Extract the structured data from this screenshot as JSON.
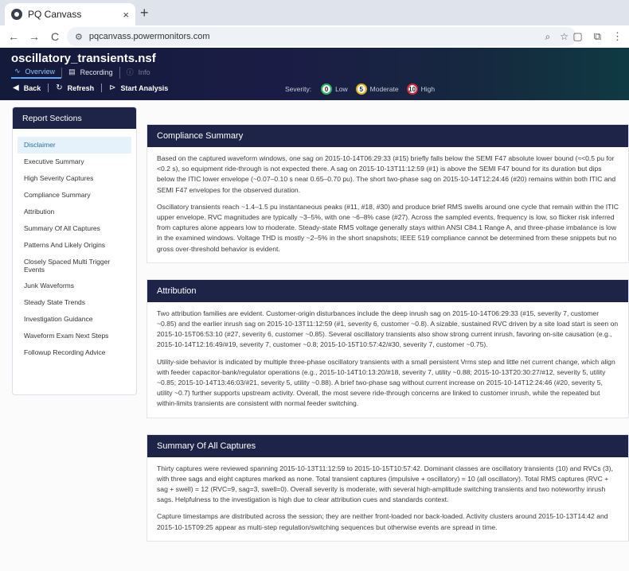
{
  "browser": {
    "tab_title": "PQ Canvass",
    "tab_close": "×",
    "new_tab": "+",
    "back": "←",
    "forward": "→",
    "reload": "C",
    "url": "pqcanvass.powermonitors.com"
  },
  "app": {
    "file_title": "oscillatory_transients.nsf",
    "nav": [
      {
        "label": "Overview",
        "state": "active"
      },
      {
        "label": "Recording",
        "state": "normal"
      },
      {
        "label": "Info",
        "state": "disabled"
      }
    ],
    "actions": {
      "back": "Back",
      "refresh": "Refresh",
      "start_analysis": "Start Analysis"
    },
    "severity": {
      "label": "Severity:",
      "levels": [
        {
          "badge": "0",
          "label": "Low",
          "color": "#2ab35a"
        },
        {
          "badge": "5",
          "label": "Moderate",
          "color": "#e0b21a"
        },
        {
          "badge": "10",
          "label": "High",
          "color": "#d6263a"
        }
      ]
    }
  },
  "sidebar": {
    "title": "Report Sections",
    "items": [
      "Disclaimer",
      "Executive Summary",
      "High Severity Captures",
      "Compliance Summary",
      "Attribution",
      "Summary Of All Captures",
      "Patterns And Likely Origins",
      "Closely Spaced Multi Trigger Events",
      "Junk Waveforms",
      "Steady State Trends",
      "Investigation Guidance",
      "Waveform Exam Next Steps",
      "Followup Recording Advice"
    ],
    "selected": "Disclaimer"
  },
  "sections": [
    {
      "title": "Compliance Summary",
      "paragraphs": [
        "Based on the captured waveform windows, one sag on 2015-10-14T06:29:33 (#15) briefly falls below the SEMI F47 absolute lower bound (≈<0.5 pu for <0.2 s), so equipment ride-through is not expected there. A sag on 2015-10-13T11:12:59 (#1) is above the SEMI F47 bound for its duration but dips below the ITIC lower envelope (~0.07–0.10 s near 0.65–0.70 pu). The short two-phase sag on 2015-10-14T12:24:46 (#20) remains within both ITIC and SEMI F47 envelopes for the observed duration.",
        "Oscillatory transients reach ~1.4–1.5 pu instantaneous peaks (#11, #18, #30) and produce brief RMS swells around one cycle that remain within the ITIC upper envelope. RVC magnitudes are typically ~3–5%, with one ~6–8% case (#27). Across the sampled events, frequency is low, so flicker risk inferred from captures alone appears low to moderate. Steady-state RMS voltage generally stays within ANSI C84.1 Range A, and three-phase imbalance is low in the examined windows. Voltage THD is mostly ~2–5% in the short snapshots; IEEE 519 compliance cannot be determined from these snippets but no gross over-threshold behavior is evident."
      ]
    },
    {
      "title": "Attribution",
      "paragraphs": [
        "Two attribution families are evident. Customer-origin disturbances include the deep inrush sag on 2015-10-14T06:29:33 (#15, severity 7, customer ~0.85) and the earlier inrush sag on 2015-10-13T11:12:59 (#1, severity 6, customer ~0.8). A sizable, sustained RVC driven by a site load start is seen on 2015-10-15T06:53:10 (#27, severity 6, customer ~0.85). Several oscillatory transients also show strong current inrush, favoring on-site causation (e.g., 2015-10-14T12:16:49/#19, severity 7, customer ~0.8; 2015-10-15T10:57:42/#30, severity 7, customer ~0.75).",
        "Utility-side behavior is indicated by multiple three-phase oscillatory transients with a small persistent Vrms step and little net current change, which align with feeder capacitor-bank/regulator operations (e.g., 2015-10-14T10:13:20/#18, severity 7, utility ~0.88; 2015-10-13T20:30:27/#12, severity 5, utility ~0.85; 2015-10-14T13:46:03/#21, severity 5, utility ~0.88). A brief two-phase sag without current increase on 2015-10-14T12:24:46 (#20, severity 5, utility ~0.7) further supports upstream activity. Overall, the most severe ride-through concerns are linked to customer inrush, while the repeated but within-limits transients are consistent with normal feeder switching."
      ]
    },
    {
      "title": "Summary Of All Captures",
      "paragraphs": [
        "Thirty captures were reviewed spanning 2015-10-13T11:12:59 to 2015-10-15T10:57:42. Dominant classes are oscillatory transients (10) and RVCs (3), with three sags and eight captures marked as none. Total transient captures (impulsive + oscillatory) = 10 (all oscillatory). Total RMS captures (RVC + sag + swell) = 12 (RVC=9, sag=3, swell=0). Overall severity is moderate, with several high-amplitude switching transients and two noteworthy inrush sags. Helpfulness to the investigation is high due to clear attribution cues and standards context.",
        "Capture timestamps are distributed across the session; they are neither front-loaded nor back-loaded. Activity clusters around 2015-10-13T14:42 and 2015-10-15T09:25 appear as multi-step regulation/switching sequences but otherwise events are spread in time."
      ]
    }
  ]
}
